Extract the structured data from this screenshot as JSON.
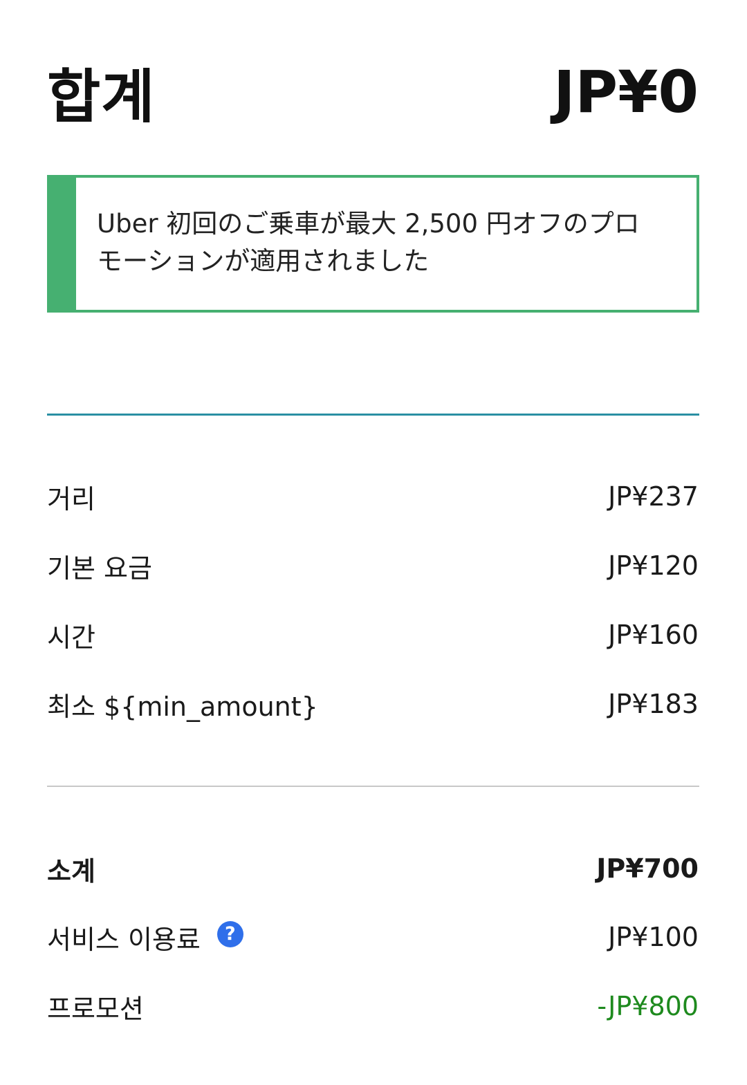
{
  "header": {
    "total_label": "합계",
    "total_amount": "JP¥0"
  },
  "promo_banner": {
    "line1": "Uber 初回のご乗車が最大 2,500 円オフのプロ",
    "line2": "モーションが適用されました",
    "accent_color": "#46b071"
  },
  "fare_items": [
    {
      "label": "거리",
      "value": "JP¥237"
    },
    {
      "label": "기본 요금",
      "value": "JP¥120"
    },
    {
      "label": "시간",
      "value": "JP¥160"
    },
    {
      "label": "최소 ${min_amount}",
      "value": "JP¥183"
    }
  ],
  "summary": {
    "subtotal_label": "소계",
    "subtotal_value": "JP¥700",
    "service_fee_label": "서비스 이용료",
    "service_fee_help_icon": "question-mark-icon",
    "service_fee_help_glyph": "?",
    "service_fee_value": "JP¥100",
    "promotion_label": "프로모션",
    "promotion_value": "-JP¥800",
    "promotion_color": "#1e8a1e"
  }
}
